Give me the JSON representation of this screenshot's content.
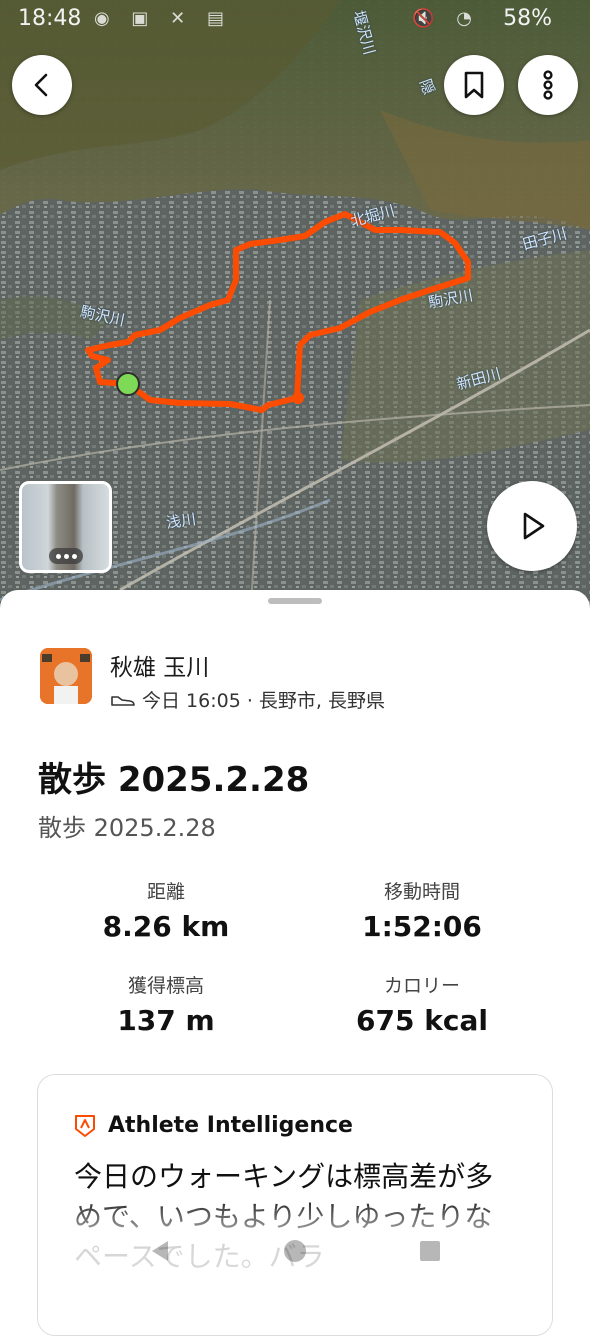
{
  "status_bar": {
    "time": "18:48",
    "battery": "58%",
    "left_icons": [
      "messenger-icon",
      "app-icon",
      "x-icon",
      "app-icon"
    ],
    "right_icons": [
      "mute-icon",
      "wifi-icon",
      "battery-icon"
    ]
  },
  "map": {
    "route_color": "#fc4c02",
    "start_marker_color": "#7ed957",
    "river_labels": [
      "堰沢川",
      "隠",
      "北堀川",
      "田子川",
      "駒沢川",
      "駒沢川",
      "新田川",
      "浅川"
    ]
  },
  "top_buttons": {
    "back": "chevron-left-icon",
    "bookmark": "bookmark-icon",
    "more": "more-vertical-icon"
  },
  "play_button": "play-icon",
  "athlete": {
    "name": "秋雄 玉川",
    "activity_icon": "shoe-icon",
    "meta": "今日 16:05 · 長野市, 長野県"
  },
  "activity": {
    "title": "散歩 2025.2.28",
    "description": "散歩 2025.2.28"
  },
  "stats": {
    "distance_label": "距離",
    "distance_value": "8.26 km",
    "moving_time_label": "移動時間",
    "moving_time_value": "1:52:06",
    "elevation_label": "獲得標高",
    "elevation_value": "137 m",
    "calories_label": "カロリー",
    "calories_value": "675 kcal"
  },
  "ai_card": {
    "title": "Athlete Intelligence",
    "body": "今日のウォーキングは標高差が多めで、いつもより少しゆったりなペースでした。バラ"
  },
  "colors": {
    "accent": "#fc4c02",
    "text": "#111111"
  }
}
